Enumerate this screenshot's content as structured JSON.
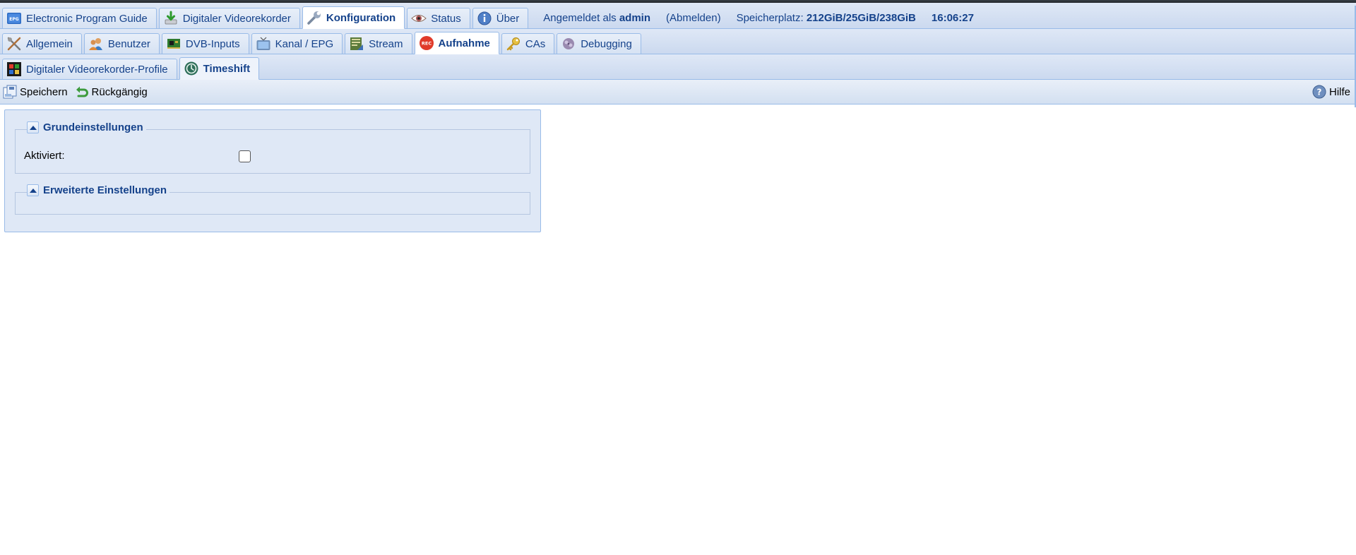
{
  "nav": {
    "main_tabs": [
      {
        "label": "Electronic Program Guide",
        "icon": "epg-icon"
      },
      {
        "label": "Digitaler Videorekorder",
        "icon": "download-icon"
      },
      {
        "label": "Konfiguration",
        "icon": "wrench-icon",
        "active": true
      },
      {
        "label": "Status",
        "icon": "eye-icon"
      },
      {
        "label": "Über",
        "icon": "info-icon"
      }
    ],
    "status": {
      "logged_in_prefix": "Angemeldet als",
      "user": "admin",
      "logout": "(Abmelden)",
      "storage_prefix": "Speicherplatz:",
      "storage_value": "212GiB/25GiB/238GiB",
      "time": "16:06:27"
    },
    "config_tabs": [
      {
        "label": "Allgemein",
        "icon": "tools-icon"
      },
      {
        "label": "Benutzer",
        "icon": "users-icon"
      },
      {
        "label": "DVB-Inputs",
        "icon": "card-icon"
      },
      {
        "label": "Kanal / EPG",
        "icon": "tv-icon"
      },
      {
        "label": "Stream",
        "icon": "stream-icon"
      },
      {
        "label": "Aufnahme",
        "icon": "rec-icon",
        "active": true
      },
      {
        "label": "CAs",
        "icon": "key-icon"
      },
      {
        "label": "Debugging",
        "icon": "bug-icon"
      }
    ],
    "recording_tabs": [
      {
        "label": "Digitaler Videorekorder-Profile",
        "icon": "profile-icon"
      },
      {
        "label": "Timeshift",
        "icon": "timeshift-icon",
        "active": true
      }
    ]
  },
  "toolbar": {
    "save_label": "Speichern",
    "undo_label": "Rückgängig",
    "help_label": "Hilfe"
  },
  "form": {
    "basic_legend": "Grundeinstellungen",
    "enabled_label": "Aktiviert:",
    "enabled_value": false,
    "advanced_legend": "Erweiterte Einstellungen"
  },
  "colors": {
    "accent": "#15428b",
    "border": "#99bbe8",
    "tab_bg": "#dfe8f6"
  }
}
